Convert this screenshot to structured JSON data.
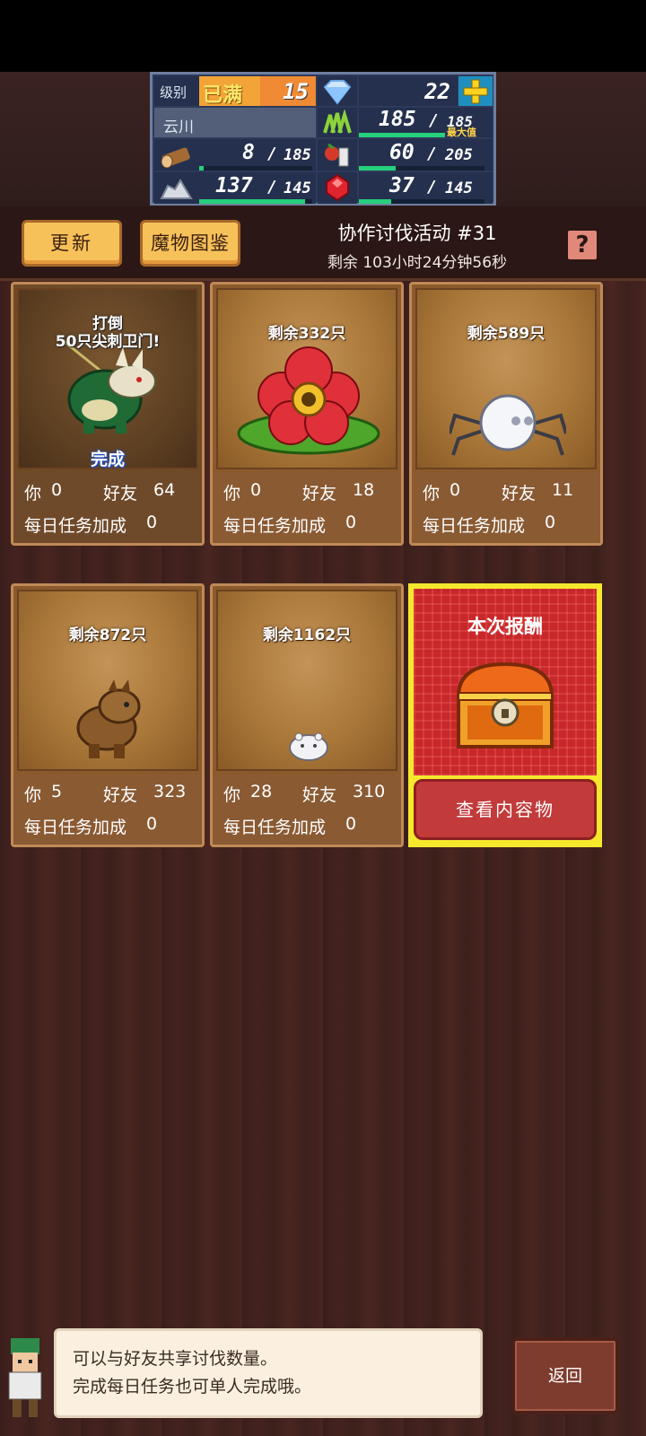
{
  "hud": {
    "level_label": "级别",
    "maxed_label": "已满",
    "level": "15",
    "gems": "22",
    "player_name": "云川",
    "grass": "185",
    "grass_max": "185",
    "grass_max_tag": "最大值",
    "wood": "8",
    "wood_max": "185",
    "food": "60",
    "food_max": "205",
    "stone": "137",
    "stone_max": "145",
    "ruby": "37",
    "ruby_max": "145",
    "wood_fill": 0.04,
    "food_fill": 0.29,
    "stone_fill": 0.94,
    "ruby_fill": 0.26,
    "grass_fill": 1.0
  },
  "toolbar": {
    "refresh_label": "更新",
    "bestiary_label": "魔物图鉴",
    "event_title": "协作讨伐活动 #31",
    "event_time": "剩余 103小时24分钟56秒",
    "help_label": "?"
  },
  "cards": [
    {
      "remain": "打倒\n50只尖刺卫门!",
      "done": "完成",
      "you_label": "你",
      "you": "0",
      "friend_label": "好友",
      "friend": "64",
      "bonus_label": "每日任务加成",
      "bonus": "0"
    },
    {
      "remain": "剩余332只",
      "you_label": "你",
      "you": "0",
      "friend_label": "好友",
      "friend": "18",
      "bonus_label": "每日任务加成",
      "bonus": "0"
    },
    {
      "remain": "剩余589只",
      "you_label": "你",
      "you": "0",
      "friend_label": "好友",
      "friend": "11",
      "bonus_label": "每日任务加成",
      "bonus": "0"
    },
    {
      "remain": "剩余872只",
      "you_label": "你",
      "you": "5",
      "friend_label": "好友",
      "friend": "323",
      "bonus_label": "每日任务加成",
      "bonus": "0"
    },
    {
      "remain": "剩余1162只",
      "you_label": "你",
      "you": "28",
      "friend_label": "好友",
      "friend": "310",
      "bonus_label": "每日任务加成",
      "bonus": "0"
    }
  ],
  "reward": {
    "label": "本次报酬",
    "button": "查看内容物"
  },
  "dialog": {
    "line1": "可以与好友共享讨伐数量。",
    "line2": "完成每日任务也可单人完成哦。"
  },
  "back_label": "返回",
  "colors": {
    "accent": "#f7c15a",
    "reward_bg": "#c8282a",
    "reward_border": "#f6e82c",
    "bar": "#26d07c"
  }
}
